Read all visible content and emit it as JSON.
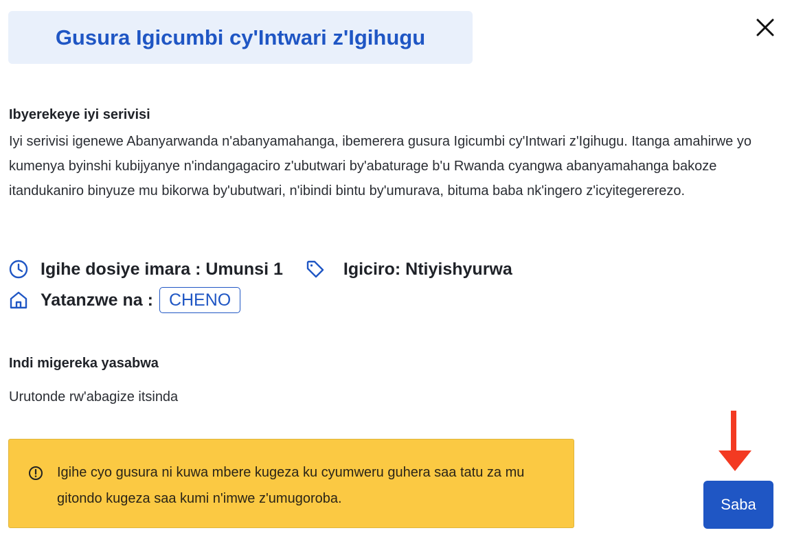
{
  "modal": {
    "title": "Gusura Igicumbi cy'Intwari z'Igihugu",
    "about_heading": "Ibyerekeye iyi serivisi",
    "about_text": "Iyi serivisi igenewe Abanyarwanda n'abanyamahanga, ibemerera gusura Igicumbi cy'Intwari z'Igihugu. Itanga amahirwe yo kumenya byinshi kubijyanye n'indangagaciro z'ubutwari by'abaturage b'u Rwanda cyangwa abanyamahanga bakoze itandukaniro binyuze mu bikorwa by'ubutwari, n'ibindi bintu by'umurava, bituma baba nk'ingero z'icyitegererezo.",
    "processing_time": "Igihe dosiye imara : Umunsi 1",
    "price": "Igiciro: Ntiyishyurwa",
    "provided_by_label": "Yatanzwe na :",
    "provider": "CHENO",
    "requirements_heading": "Indi migereka yasabwa",
    "requirements": [
      "Urutonde rw'abagize itsinda"
    ],
    "notice": "Igihe cyo gusura ni kuwa mbere kugeza ku cyumweru guhera saa tatu za mu gitondo kugeza saa kumi n'imwe z'umugoroba.",
    "apply_button": "Saba"
  },
  "icons": {
    "close": "close-icon",
    "clock": "clock-icon",
    "tag": "tag-icon",
    "home": "home-icon",
    "alert": "alert-circle-icon",
    "arrow": "red-arrow-down-icon"
  },
  "colors": {
    "primary": "#1f56c4",
    "title_bg": "#e9f0fb",
    "warning_bg": "#fbc943",
    "arrow": "#f33a22"
  }
}
